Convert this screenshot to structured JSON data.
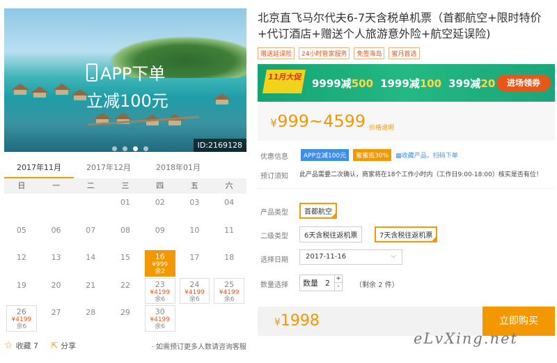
{
  "hero": {
    "banner_line1": "APP下单",
    "banner_line2": "立减100元",
    "image_id": "ID:2169128"
  },
  "calendar": {
    "months": [
      "2017年11月",
      "2017年12月",
      "2018年01月"
    ],
    "active_month": 0,
    "weekdays": [
      "日",
      "一",
      "二",
      "三",
      "四",
      "五",
      "六"
    ],
    "days": [
      {
        "d": ""
      },
      {
        "d": ""
      },
      {
        "d": ""
      },
      {
        "d": "01"
      },
      {
        "d": "02"
      },
      {
        "d": "03"
      },
      {
        "d": "04"
      },
      {
        "d": "05"
      },
      {
        "d": "06"
      },
      {
        "d": "07"
      },
      {
        "d": "08"
      },
      {
        "d": "09"
      },
      {
        "d": "10"
      },
      {
        "d": "11"
      },
      {
        "d": "12"
      },
      {
        "d": "13"
      },
      {
        "d": "14"
      },
      {
        "d": "15"
      },
      {
        "d": "16",
        "price": "¥999",
        "stock": "余2",
        "selected": true
      },
      {
        "d": "17"
      },
      {
        "d": "18"
      },
      {
        "d": "19"
      },
      {
        "d": "20"
      },
      {
        "d": "21"
      },
      {
        "d": "22"
      },
      {
        "d": "23",
        "price": "¥4199",
        "stock": "余6"
      },
      {
        "d": "24",
        "price": "¥4199",
        "stock": "余6"
      },
      {
        "d": "25",
        "price": "¥4199",
        "stock": "余6"
      },
      {
        "d": "26",
        "price": "¥4199",
        "stock": "余6"
      },
      {
        "d": "27"
      },
      {
        "d": "28"
      },
      {
        "d": "29"
      },
      {
        "d": "30",
        "price": "¥4199",
        "stock": "余6"
      }
    ]
  },
  "bottom": {
    "favorite": "收藏 7",
    "share": "分享",
    "hint": "· 如需预订更多人数请咨询客服"
  },
  "product": {
    "title": "北京直飞马尔代夫6-7天含税单机票（首都航空+限时特价+代订酒店+赠送个人旅游意外险+航空延误险)",
    "tags": [
      "赠送延误险",
      "24小时管家服务",
      "免签海岛",
      "蜜月首选"
    ],
    "promo": {
      "badge": "11月大促",
      "offers": [
        {
          "a": "9999减",
          "b": "500"
        },
        {
          "a": "1999减",
          "b": "100"
        },
        {
          "a": "399减",
          "b": "20"
        }
      ],
      "cta": "进场领券"
    },
    "price_range": "999~4599",
    "currency": "¥",
    "price_note": "价格说明",
    "offers_label": "优惠信息",
    "offer_badges": [
      "APP立减100元",
      "蜜蜜抵30%"
    ],
    "offer_qr": "收藏产品，扫码下单",
    "notice_label": "预订须知",
    "notice": "此产品需要二次确认，商家将在18个工作小时内（工作日9:00-18:00）核实是否有位！",
    "type_label": "产品类型",
    "type_option": "首都航空",
    "sub_label": "二级类型",
    "sub_options": [
      "6天含税往返机票",
      "7天含税往返机票"
    ],
    "date_label": "选择日期",
    "date_value": "2017-11-16",
    "qty_label": "数量选择",
    "qty_text": "数量",
    "qty_value": "2",
    "remain": "（剩余 2 件）",
    "total": "1998",
    "buy": "立即购买"
  },
  "watermark": "eLvXing.net"
}
